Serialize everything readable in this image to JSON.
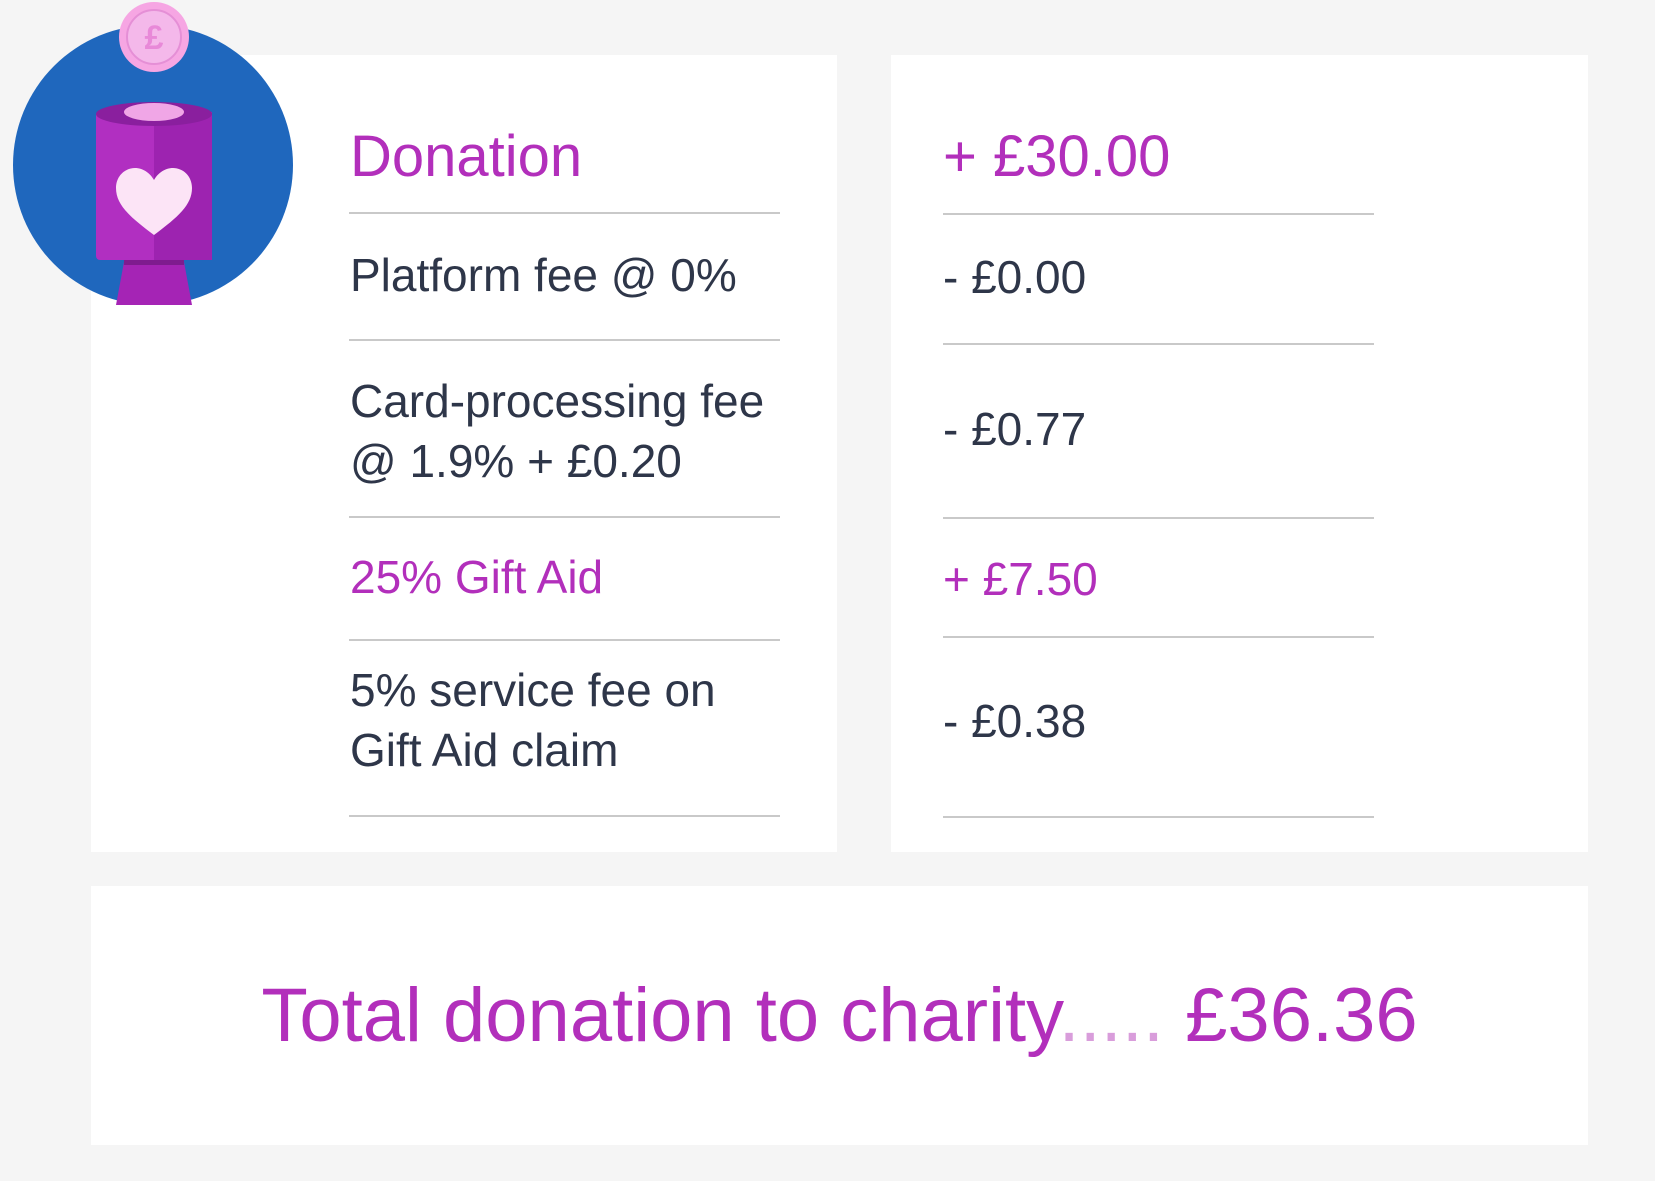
{
  "breakdown": {
    "rows": [
      {
        "label": "Donation",
        "amount": "+ £30.00"
      },
      {
        "label": "Platform fee @ 0%",
        "amount": "- £0.00"
      },
      {
        "label_line1": "Card-processing fee",
        "label_line2": "@ 1.9% + £0.20",
        "amount": "- £0.77"
      },
      {
        "label": "25% Gift Aid",
        "amount": "+ £7.50"
      },
      {
        "label_line1": "5% service fee on",
        "label_line2": "Gift Aid claim",
        "amount": "- £0.38"
      }
    ]
  },
  "total": {
    "label": "Total donation to charity",
    "dots": ".....",
    "amount": "£36.36"
  },
  "icons": {
    "collection_tin": "donation-tin-icon",
    "coin": "pound-coin-icon",
    "heart": "heart-icon"
  },
  "colors": {
    "accent": "#b22fbb",
    "text": "#2e3649",
    "icon_circle": "#1f67bd",
    "background": "#f5f5f5"
  }
}
